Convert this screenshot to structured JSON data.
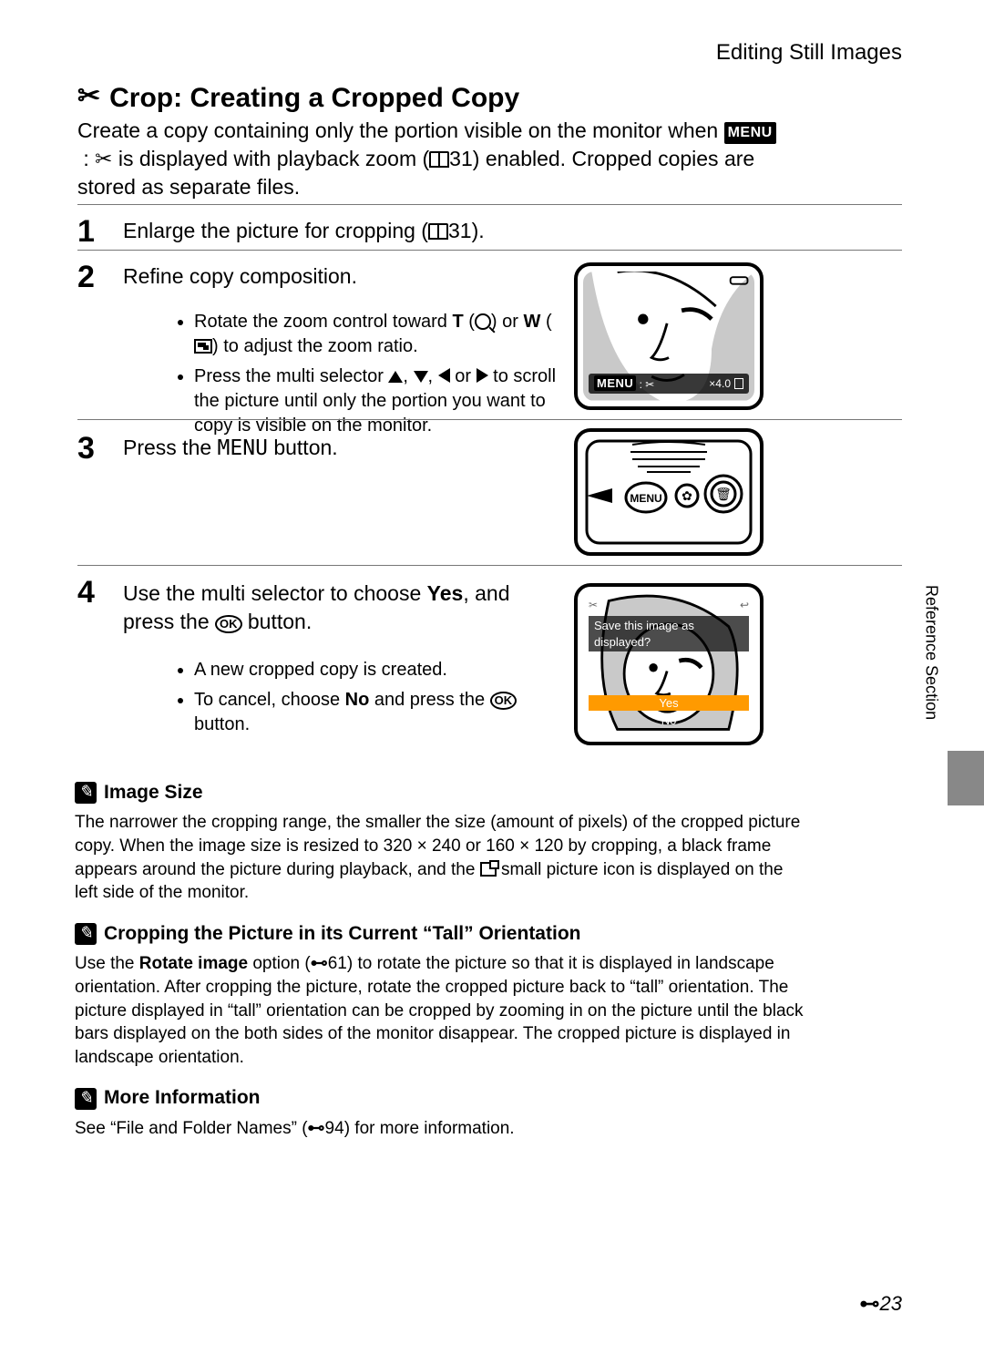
{
  "header": "Editing Still Images",
  "title": "Crop: Creating a Cropped Copy",
  "intro_a": "Create a copy containing only the portion visible on the monitor when ",
  "intro_b": " is displayed with playback zoom (",
  "intro_ref1": "31",
  "intro_c": ") enabled. Cropped copies are stored as separate files.",
  "menu_label": "MENU",
  "steps": {
    "s1a": "Enlarge the picture for cropping (",
    "s1ref": "31",
    "s1b": ").",
    "s2": "Refine copy composition.",
    "s2_b1a": "Rotate the zoom control toward ",
    "s2_b1_T": "T",
    "s2_b1_or": " or ",
    "s2_b1_W": "W",
    "s2_b1b": " to adjust the zoom ratio.",
    "s2_b2a": "Press the multi selector ",
    "s2_b2b": " to scroll the picture until only the portion you want to copy is visible on the monitor.",
    "s3a": "Press the ",
    "s3menu": "MENU",
    "s3b": " button.",
    "s4a": "Use the multi selector to choose ",
    "s4yes": "Yes",
    "s4b": ", and press the ",
    "s4c": " button.",
    "s4_b1": "A new cropped copy is created.",
    "s4_b2a": "To cancel, choose ",
    "s4_no": "No",
    "s4_b2b": " and press the ",
    "s4_b2c": " button."
  },
  "fig1": {
    "menu": "MENU",
    "scissors": "✂",
    "zoom": "×4.0"
  },
  "fig3": {
    "prompt": "Save this image as displayed?",
    "yes": "Yes",
    "no": "No"
  },
  "notes": {
    "t1": "Image Size",
    "b1a": "The narrower the cropping range, the smaller the size (amount of pixels) of the cropped picture copy. When the image size is resized to 320 × 240 or 160 × 120 by cropping, a black frame appears around the picture during playback, and the ",
    "b1b": " small picture icon is displayed on the left side of the monitor.",
    "t2": "Cropping the Picture in its Current “Tall” Orientation",
    "b2a": "Use the ",
    "b2_rot": "Rotate image",
    "b2b": " option (",
    "b2ref": "61",
    "b2c": ") to rotate the picture so that it is displayed in landscape orientation. After cropping the picture, rotate the cropped picture back to “tall” orientation. The picture displayed in “tall” orientation can be cropped by zooming in on the picture until the black bars displayed on the both sides of the monitor disappear. The cropped picture is displayed in landscape orientation.",
    "t3": "More Information",
    "b3a": "See “File and Folder Names” (",
    "b3ref": "94",
    "b3b": ") for more information."
  },
  "sidebar": "Reference Section",
  "page_number": "23",
  "ok_label": "OK",
  "icons": {
    "crop": "✂",
    "back": "↩",
    "link": "⊷"
  }
}
